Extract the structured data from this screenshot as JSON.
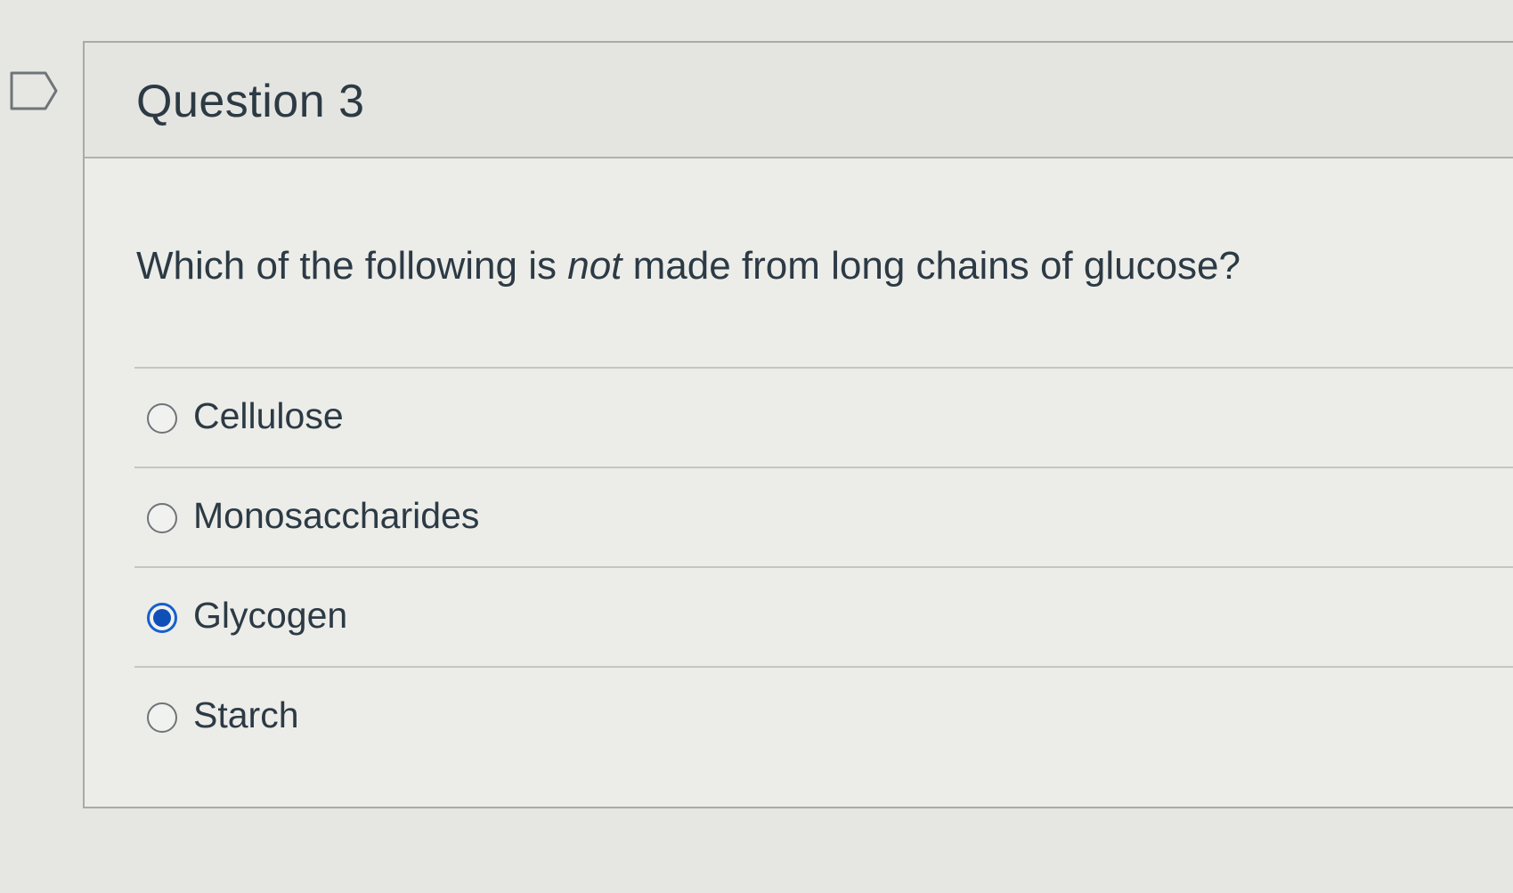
{
  "question": {
    "title": "Question 3",
    "prompt_before": "Which of the following is ",
    "prompt_emphasis": "not",
    "prompt_after": " made from long chains of glucose?"
  },
  "answers": [
    {
      "label": "Cellulose",
      "selected": false
    },
    {
      "label": "Monosaccharides",
      "selected": false
    },
    {
      "label": "Glycogen",
      "selected": true
    },
    {
      "label": "Starch",
      "selected": false
    }
  ],
  "icons": {
    "flag": "flag-outline-icon",
    "radio_unchecked": "radio-unchecked-icon",
    "radio_checked": "radio-checked-icon"
  },
  "colors": {
    "accent": "#0f4fb8",
    "text": "#2c3a44",
    "border": "#a9aaa7"
  }
}
